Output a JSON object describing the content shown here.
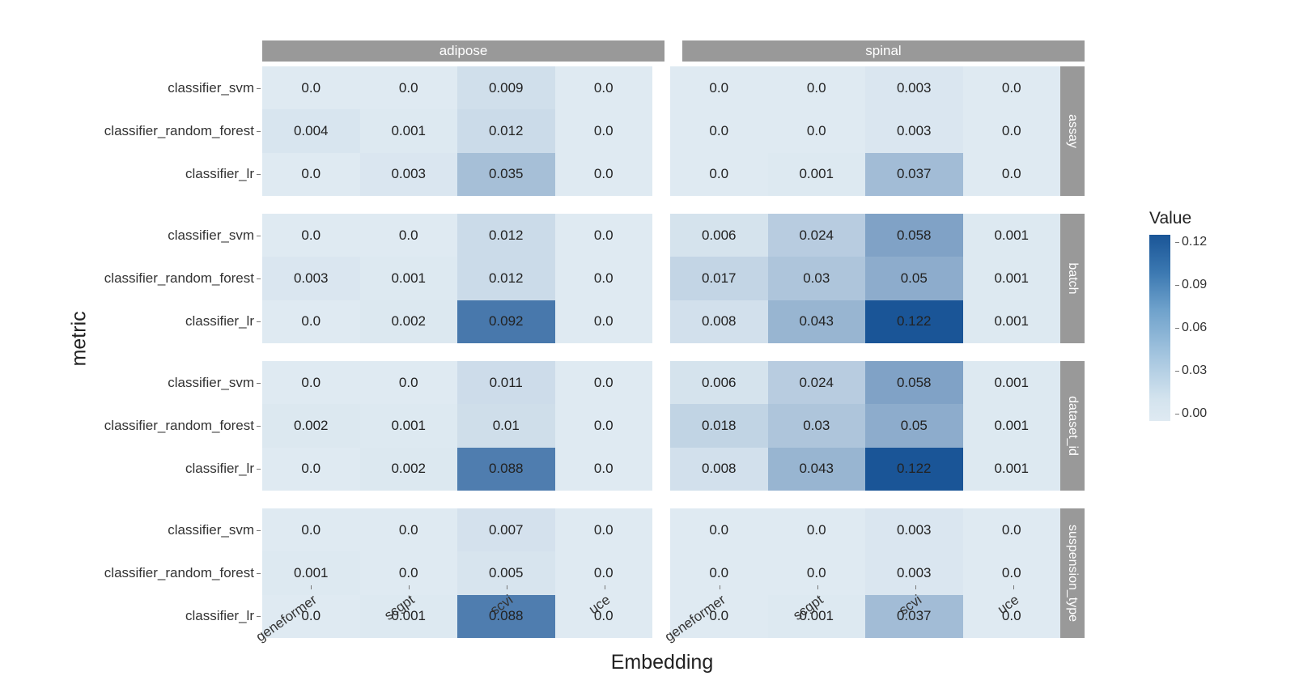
{
  "axis": {
    "x_title": "Embedding",
    "y_title": "metric"
  },
  "legend": {
    "title": "Value",
    "ticks": [
      "0.12",
      "0.09",
      "0.06",
      "0.03",
      "0.00"
    ],
    "min": 0.0,
    "max": 0.12
  },
  "cols": [
    "adipose",
    "spinal"
  ],
  "row_facets": [
    "assay",
    "batch",
    "dataset_id",
    "suspension_type"
  ],
  "x_categories": [
    "geneformer",
    "scgpt",
    "scvi",
    "uce"
  ],
  "y_categories": [
    "classifier_svm",
    "classifier_random_forest",
    "classifier_lr"
  ],
  "chart_data": {
    "type": "heatmap",
    "value_label": "Value",
    "value_range": [
      0.0,
      0.12
    ],
    "x": [
      "geneformer",
      "scgpt",
      "scvi",
      "uce"
    ],
    "y": [
      "classifier_svm",
      "classifier_random_forest",
      "classifier_lr"
    ],
    "col_facets": [
      "adipose",
      "spinal"
    ],
    "row_facets": [
      "assay",
      "batch",
      "dataset_id",
      "suspension_type"
    ],
    "panels": {
      "assay": {
        "adipose": {
          "classifier_svm": [
            0.0,
            0.0,
            0.009,
            0.0
          ],
          "classifier_random_forest": [
            0.004,
            0.001,
            0.012,
            0.0
          ],
          "classifier_lr": [
            0.0,
            0.003,
            0.035,
            0.0
          ]
        },
        "spinal": {
          "classifier_svm": [
            0.0,
            0.0,
            0.003,
            0.0
          ],
          "classifier_random_forest": [
            0.0,
            0.0,
            0.003,
            0.0
          ],
          "classifier_lr": [
            0.0,
            0.001,
            0.037,
            0.0
          ]
        }
      },
      "batch": {
        "adipose": {
          "classifier_svm": [
            0.0,
            0.0,
            0.012,
            0.0
          ],
          "classifier_random_forest": [
            0.003,
            0.001,
            0.012,
            0.0
          ],
          "classifier_lr": [
            0.0,
            0.002,
            0.092,
            0.0
          ]
        },
        "spinal": {
          "classifier_svm": [
            0.006,
            0.024,
            0.058,
            0.001
          ],
          "classifier_random_forest": [
            0.017,
            0.03,
            0.05,
            0.001
          ],
          "classifier_lr": [
            0.008,
            0.043,
            0.122,
            0.001
          ]
        }
      },
      "dataset_id": {
        "adipose": {
          "classifier_svm": [
            0.0,
            0.0,
            0.011,
            0.0
          ],
          "classifier_random_forest": [
            0.002,
            0.001,
            0.01,
            0.0
          ],
          "classifier_lr": [
            0.0,
            0.002,
            0.088,
            0.0
          ]
        },
        "spinal": {
          "classifier_svm": [
            0.006,
            0.024,
            0.058,
            0.001
          ],
          "classifier_random_forest": [
            0.018,
            0.03,
            0.05,
            0.001
          ],
          "classifier_lr": [
            0.008,
            0.043,
            0.122,
            0.001
          ]
        }
      },
      "suspension_type": {
        "adipose": {
          "classifier_svm": [
            0.0,
            0.0,
            0.007,
            0.0
          ],
          "classifier_random_forest": [
            0.001,
            0.0,
            0.005,
            0.0
          ],
          "classifier_lr": [
            0.0,
            0.001,
            0.088,
            0.0
          ]
        },
        "spinal": {
          "classifier_svm": [
            0.0,
            0.0,
            0.003,
            0.0
          ],
          "classifier_random_forest": [
            0.0,
            0.0,
            0.003,
            0.0
          ],
          "classifier_lr": [
            0.0,
            0.001,
            0.037,
            0.0
          ]
        }
      }
    }
  }
}
